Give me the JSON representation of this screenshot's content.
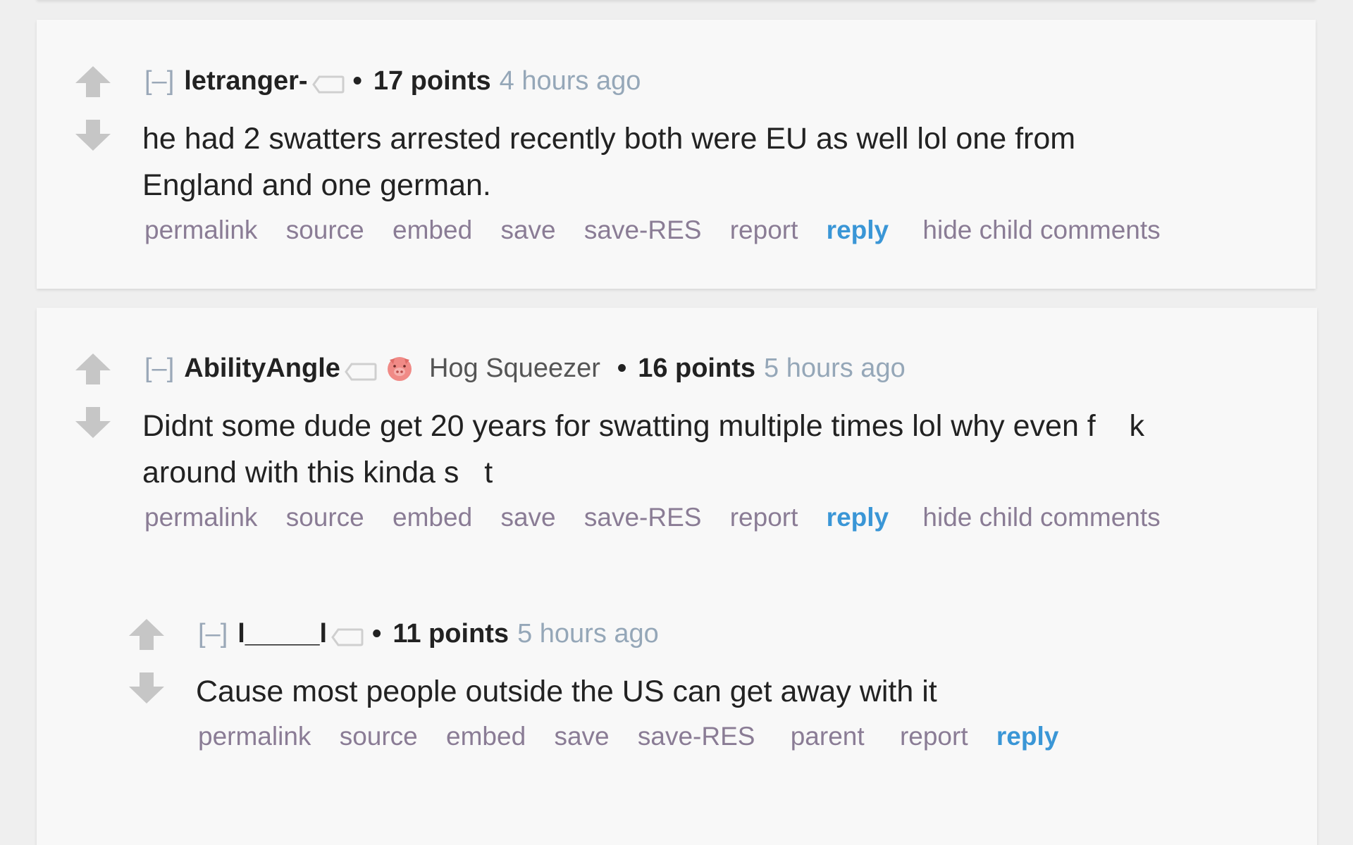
{
  "comments": [
    {
      "expand": "[–]",
      "author": "letranger-",
      "bullet": "•",
      "score": "17 points",
      "time": "4 hours ago",
      "body_line1": "he had 2 swatters arrested recently both were EU as well lol one from",
      "body_line2": "England and one german.",
      "buttons": [
        "permalink",
        "source",
        "embed",
        "save",
        "save-RES",
        "report",
        "reply",
        "hide child comments"
      ]
    },
    {
      "expand": "[–]",
      "author": "AbilityAngle",
      "flair_icon": "pig-icon",
      "flair_text": "Hog Squeezer",
      "bullet": "•",
      "score": "16 points",
      "time": "5 hours ago",
      "body_line1": "Didnt some dude get 20 years for swatting multiple times lol why even f    k",
      "body_line2": "around with this kinda s   t",
      "buttons": [
        "permalink",
        "source",
        "embed",
        "save",
        "save-RES",
        "report",
        "reply",
        "hide child comments"
      ]
    },
    {
      "expand": "[–]",
      "author": "l_____l",
      "bullet": "•",
      "score": "11 points",
      "time": "5 hours ago",
      "body_line1": "Cause most people outside the US can get away with it",
      "buttons": [
        "permalink",
        "source",
        "embed",
        "save",
        "save-RES",
        "parent",
        "report",
        "reply"
      ]
    }
  ],
  "colors": {
    "background": "#efefef",
    "card": "#f8f8f8",
    "link": "#8a7c95",
    "reply": "#3a96d6",
    "time": "#95a7b8"
  }
}
